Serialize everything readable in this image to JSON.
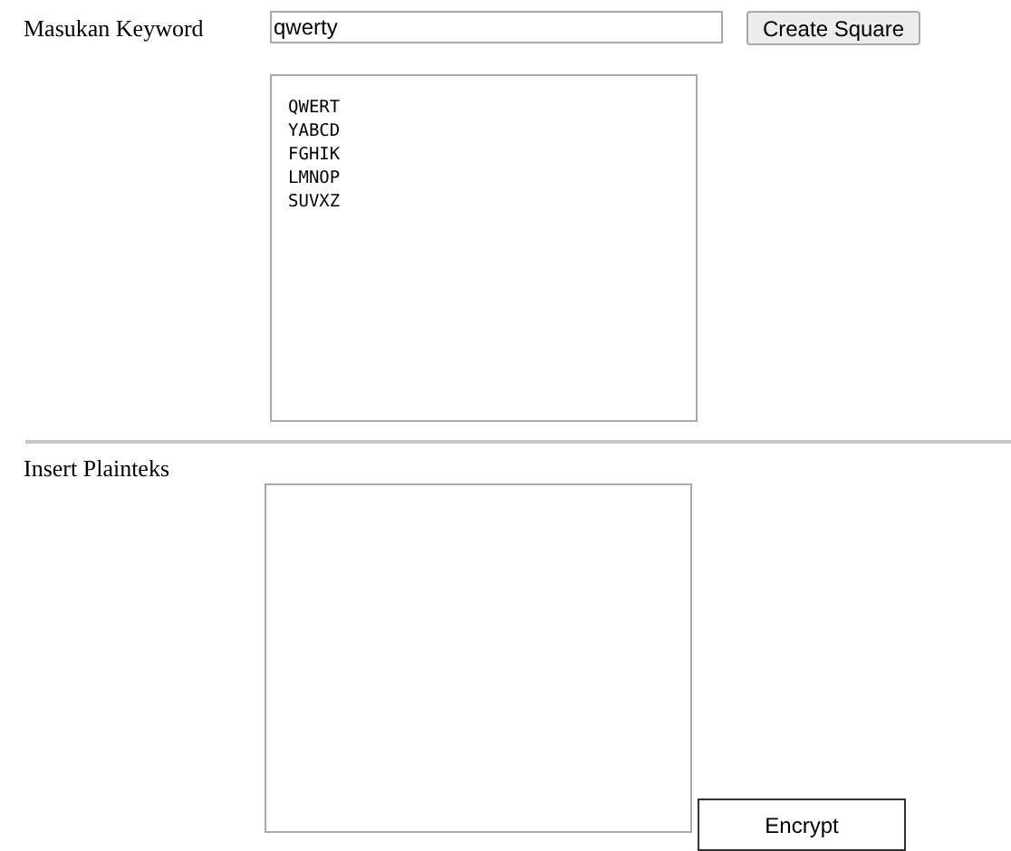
{
  "keyword": {
    "label": "Masukan Keyword",
    "value": "qwerty"
  },
  "create_button": "Create Square",
  "square": {
    "rows": [
      "QWERT",
      "YABCD",
      "FGHIK",
      "LMNOP",
      "SUVXZ"
    ]
  },
  "plaintext": {
    "label": "Insert Plainteks"
  },
  "encrypt_button": "Encrypt"
}
